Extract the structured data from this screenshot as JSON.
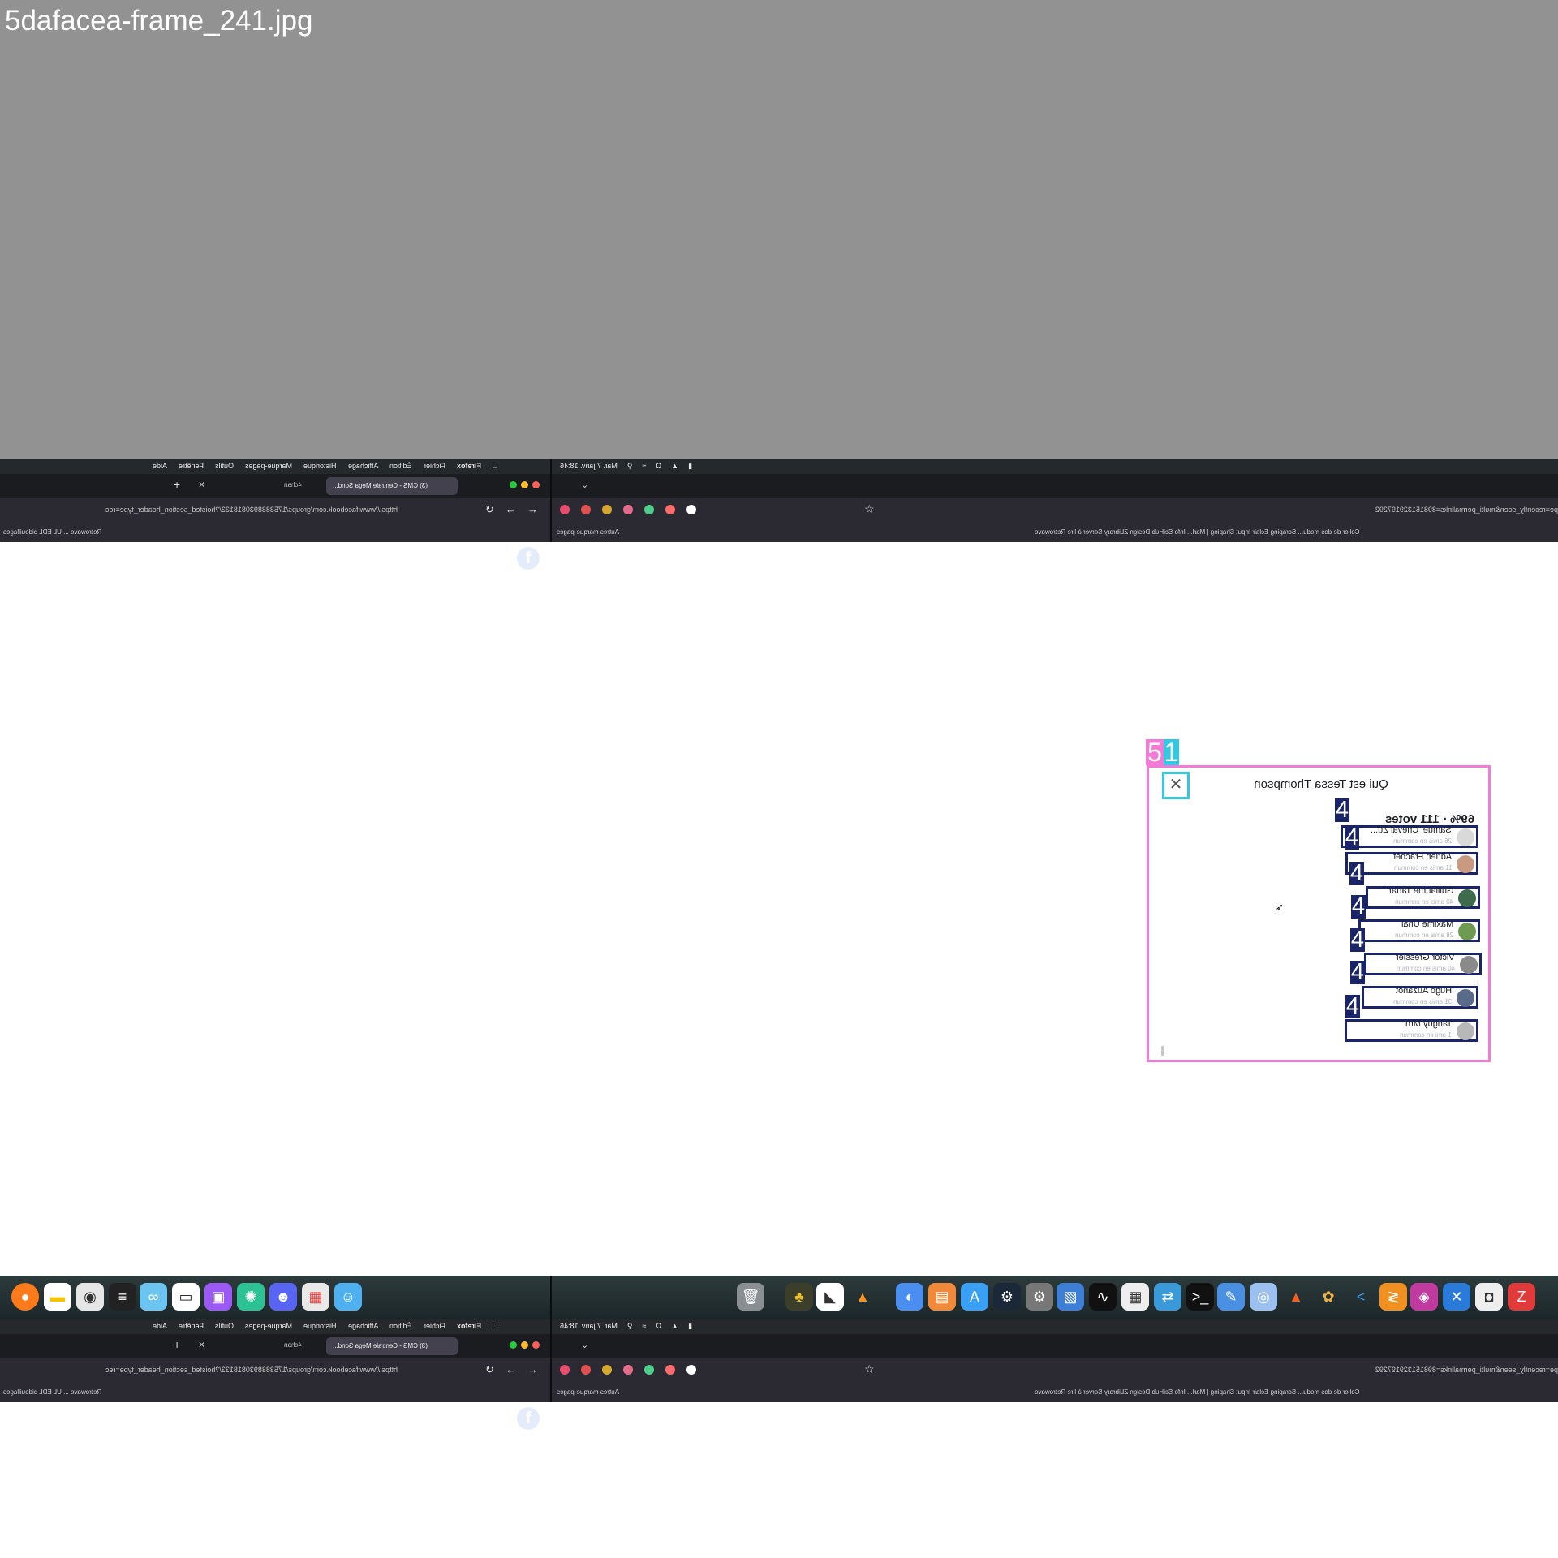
{
  "file_label": "5dafacea-frame_241.jpg",
  "browser": {
    "menu_left_items": [
      "Aide",
      "Fenêtre",
      "Outils",
      "Marque-pages",
      "Historique",
      "Affichage",
      "Édition",
      "Fichier",
      "Firefox"
    ],
    "clock": "Mar. 7 janv. 18:46",
    "tab_active_label": "(3) CMS - Centrale Mega Sond...",
    "tab_other_label": "4chan",
    "url_left": "https://www.facebook.com/groups/1753838930818133/?hoisted_section_header_type=rec",
    "url_right": "pe=recently_seen&multi_permalinks=898151329197292",
    "bookmarks_left": "Retrowave ... UL  EDL  bidouillages",
    "bookmarks_mid": "Autres marque-pages",
    "bookmarks_right": "Coller de dos modu...  Scraping  Eclair  Input Shaping | Marl...  Info  SciHub  Design  ZLibrary  Server  à lire  Retrowave",
    "colors": {
      "close": "#ff5f57",
      "minimize": "#febc2e",
      "zoom": "#28c840"
    }
  },
  "poll_modal": {
    "title": "Qui est Tessa Thompson",
    "votes": "69% · 111 votes",
    "annotation_modal_tag": "5",
    "annotation_close_tag": "1",
    "annotation_row_tag": "4",
    "voters": [
      {
        "name": "Samuel Cheval Zu...",
        "sub": "26 amis en commun"
      },
      {
        "name": "Adrien Frachet",
        "sub": "11 amis en commun"
      },
      {
        "name": "Guillaume Tartar",
        "sub": "40 amis en commun"
      },
      {
        "name": "Maxime Unal",
        "sub": "28 amis en commun"
      },
      {
        "name": "Victor Gressier",
        "sub": "40 amis en commun"
      },
      {
        "name": "Hugo Auzanot",
        "sub": "31 amis en commun"
      },
      {
        "name": "Tanguy Mrn",
        "sub": "1 ami en commun"
      }
    ],
    "colors": {
      "modal_border": "#f47ad7",
      "close_border": "#31c8e4",
      "row_border": "#1a2569"
    }
  }
}
